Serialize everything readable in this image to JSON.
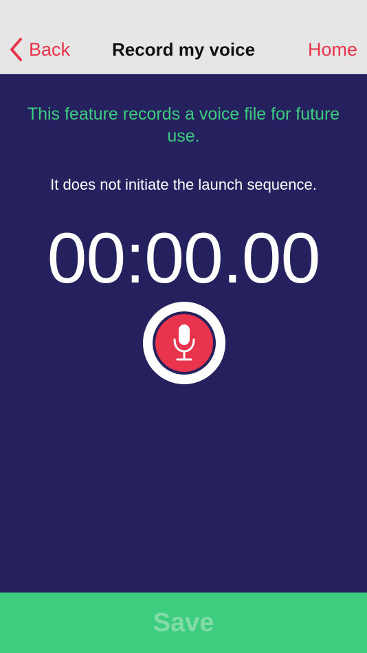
{
  "nav": {
    "back_label": "Back",
    "back_icon": "chevron-left-icon",
    "title": "Record my voice",
    "home_label": "Home"
  },
  "content": {
    "info_primary": "This feature records a voice file for future use.",
    "info_secondary": "It does not initiate the launch sequence.",
    "timer": "00:00.00",
    "record_icon": "microphone-icon"
  },
  "footer": {
    "save_label": "Save"
  },
  "colors": {
    "background": "#25215f",
    "nav_background": "#e6e6e6",
    "accent_red": "#e8344c",
    "accent_green": "#3ccd7e",
    "save_label_disabled": "#83dca8",
    "text_white": "#ffffff"
  }
}
